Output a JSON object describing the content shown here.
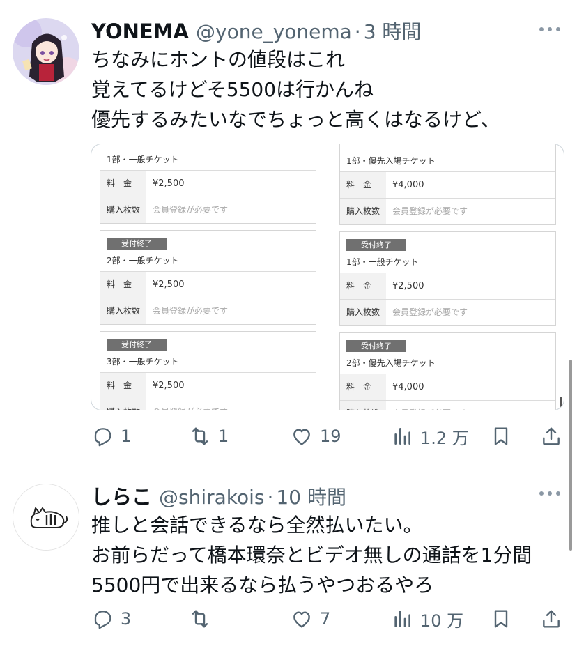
{
  "tweets": [
    {
      "name": "YONEMA",
      "handle": "@yone_yonema",
      "separator": "·",
      "time": "3 時間",
      "text": [
        "ちなみにホントの値段はこれ",
        "覚えてるけどそ5500は行かんね",
        "優先するみたいなでちょっと高くはなるけど、"
      ],
      "avatar": "anime-girl-avatar",
      "stats": {
        "replies": "1",
        "retweets": "1",
        "likes": "19",
        "views": "1.2 万"
      },
      "media": {
        "left_column": [
          {
            "badge": "",
            "title": "1部・一般チケット",
            "price_label": "料　金",
            "price": "¥2,500",
            "qty_label": "購入枚数",
            "qty_value": "会員登録が必要です"
          },
          {
            "badge": "受付終了",
            "title": "2部・一般チケット",
            "price_label": "料　金",
            "price": "¥2,500",
            "qty_label": "購入枚数",
            "qty_value": "会員登録が必要です"
          },
          {
            "badge": "受付終了",
            "title": "3部・一般チケット",
            "price_label": "料　金",
            "price": "¥2,500",
            "qty_label": "購入枚数",
            "qty_value": "会員登録が必要です"
          }
        ],
        "right_column": [
          {
            "badge": "",
            "title": "1部・優先入場チケット",
            "price_label": "料　金",
            "price": "¥4,000",
            "qty_label": "購入枚数",
            "qty_value": "会員登録が必要です"
          },
          {
            "badge": "受付終了",
            "title": "1部・一般チケット",
            "price_label": "料　金",
            "price": "¥2,500",
            "qty_label": "購入枚数",
            "qty_value": "会員登録が必要です"
          },
          {
            "badge": "受付終了",
            "title": "2部・優先入場チケット",
            "price_label": "料　金",
            "price": "¥4,000",
            "qty_label": "購入枚数",
            "qty_value": "会員登録が必要です"
          }
        ]
      }
    },
    {
      "name": "しらこ",
      "handle": "@shirakois",
      "separator": "·",
      "time": "10 時間",
      "text": [
        "推しと会話できるなら全然払いたい。",
        "お前らだって橋本環奈とビデオ無しの通話を1分間",
        "5500円で出来るなら払うやつおるやろ"
      ],
      "avatar": "sleeping-cat-avatar",
      "stats": {
        "replies": "3",
        "retweets": "",
        "likes": "7",
        "views": "10 万"
      }
    }
  ],
  "icons": {
    "reply": "reply-icon",
    "retweet": "retweet-icon",
    "like": "heart-icon",
    "views": "views-icon",
    "bookmark": "bookmark-icon",
    "share": "share-icon",
    "more": "more-icon"
  },
  "colors": {
    "text": "#0f1419",
    "secondary": "#536471",
    "divider": "#e6e6e6",
    "badge": "#707070"
  }
}
